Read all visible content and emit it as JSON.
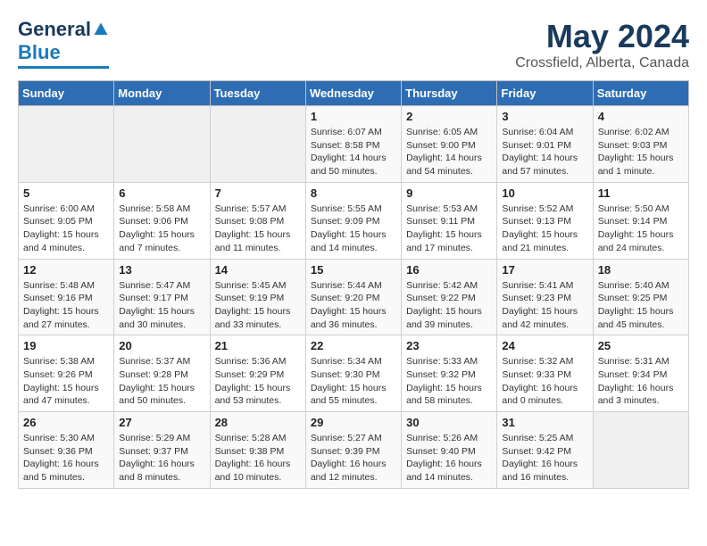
{
  "logo": {
    "text_general": "General",
    "text_blue": "Blue"
  },
  "header": {
    "title": "May 2024",
    "subtitle": "Crossfield, Alberta, Canada"
  },
  "days_of_week": [
    "Sunday",
    "Monday",
    "Tuesday",
    "Wednesday",
    "Thursday",
    "Friday",
    "Saturday"
  ],
  "weeks": [
    [
      {
        "day": "",
        "info": ""
      },
      {
        "day": "",
        "info": ""
      },
      {
        "day": "",
        "info": ""
      },
      {
        "day": "1",
        "info": "Sunrise: 6:07 AM\nSunset: 8:58 PM\nDaylight: 14 hours\nand 50 minutes."
      },
      {
        "day": "2",
        "info": "Sunrise: 6:05 AM\nSunset: 9:00 PM\nDaylight: 14 hours\nand 54 minutes."
      },
      {
        "day": "3",
        "info": "Sunrise: 6:04 AM\nSunset: 9:01 PM\nDaylight: 14 hours\nand 57 minutes."
      },
      {
        "day": "4",
        "info": "Sunrise: 6:02 AM\nSunset: 9:03 PM\nDaylight: 15 hours\nand 1 minute."
      }
    ],
    [
      {
        "day": "5",
        "info": "Sunrise: 6:00 AM\nSunset: 9:05 PM\nDaylight: 15 hours\nand 4 minutes."
      },
      {
        "day": "6",
        "info": "Sunrise: 5:58 AM\nSunset: 9:06 PM\nDaylight: 15 hours\nand 7 minutes."
      },
      {
        "day": "7",
        "info": "Sunrise: 5:57 AM\nSunset: 9:08 PM\nDaylight: 15 hours\nand 11 minutes."
      },
      {
        "day": "8",
        "info": "Sunrise: 5:55 AM\nSunset: 9:09 PM\nDaylight: 15 hours\nand 14 minutes."
      },
      {
        "day": "9",
        "info": "Sunrise: 5:53 AM\nSunset: 9:11 PM\nDaylight: 15 hours\nand 17 minutes."
      },
      {
        "day": "10",
        "info": "Sunrise: 5:52 AM\nSunset: 9:13 PM\nDaylight: 15 hours\nand 21 minutes."
      },
      {
        "day": "11",
        "info": "Sunrise: 5:50 AM\nSunset: 9:14 PM\nDaylight: 15 hours\nand 24 minutes."
      }
    ],
    [
      {
        "day": "12",
        "info": "Sunrise: 5:48 AM\nSunset: 9:16 PM\nDaylight: 15 hours\nand 27 minutes."
      },
      {
        "day": "13",
        "info": "Sunrise: 5:47 AM\nSunset: 9:17 PM\nDaylight: 15 hours\nand 30 minutes."
      },
      {
        "day": "14",
        "info": "Sunrise: 5:45 AM\nSunset: 9:19 PM\nDaylight: 15 hours\nand 33 minutes."
      },
      {
        "day": "15",
        "info": "Sunrise: 5:44 AM\nSunset: 9:20 PM\nDaylight: 15 hours\nand 36 minutes."
      },
      {
        "day": "16",
        "info": "Sunrise: 5:42 AM\nSunset: 9:22 PM\nDaylight: 15 hours\nand 39 minutes."
      },
      {
        "day": "17",
        "info": "Sunrise: 5:41 AM\nSunset: 9:23 PM\nDaylight: 15 hours\nand 42 minutes."
      },
      {
        "day": "18",
        "info": "Sunrise: 5:40 AM\nSunset: 9:25 PM\nDaylight: 15 hours\nand 45 minutes."
      }
    ],
    [
      {
        "day": "19",
        "info": "Sunrise: 5:38 AM\nSunset: 9:26 PM\nDaylight: 15 hours\nand 47 minutes."
      },
      {
        "day": "20",
        "info": "Sunrise: 5:37 AM\nSunset: 9:28 PM\nDaylight: 15 hours\nand 50 minutes."
      },
      {
        "day": "21",
        "info": "Sunrise: 5:36 AM\nSunset: 9:29 PM\nDaylight: 15 hours\nand 53 minutes."
      },
      {
        "day": "22",
        "info": "Sunrise: 5:34 AM\nSunset: 9:30 PM\nDaylight: 15 hours\nand 55 minutes."
      },
      {
        "day": "23",
        "info": "Sunrise: 5:33 AM\nSunset: 9:32 PM\nDaylight: 15 hours\nand 58 minutes."
      },
      {
        "day": "24",
        "info": "Sunrise: 5:32 AM\nSunset: 9:33 PM\nDaylight: 16 hours\nand 0 minutes."
      },
      {
        "day": "25",
        "info": "Sunrise: 5:31 AM\nSunset: 9:34 PM\nDaylight: 16 hours\nand 3 minutes."
      }
    ],
    [
      {
        "day": "26",
        "info": "Sunrise: 5:30 AM\nSunset: 9:36 PM\nDaylight: 16 hours\nand 5 minutes."
      },
      {
        "day": "27",
        "info": "Sunrise: 5:29 AM\nSunset: 9:37 PM\nDaylight: 16 hours\nand 8 minutes."
      },
      {
        "day": "28",
        "info": "Sunrise: 5:28 AM\nSunset: 9:38 PM\nDaylight: 16 hours\nand 10 minutes."
      },
      {
        "day": "29",
        "info": "Sunrise: 5:27 AM\nSunset: 9:39 PM\nDaylight: 16 hours\nand 12 minutes."
      },
      {
        "day": "30",
        "info": "Sunrise: 5:26 AM\nSunset: 9:40 PM\nDaylight: 16 hours\nand 14 minutes."
      },
      {
        "day": "31",
        "info": "Sunrise: 5:25 AM\nSunset: 9:42 PM\nDaylight: 16 hours\nand 16 minutes."
      },
      {
        "day": "",
        "info": ""
      }
    ]
  ]
}
